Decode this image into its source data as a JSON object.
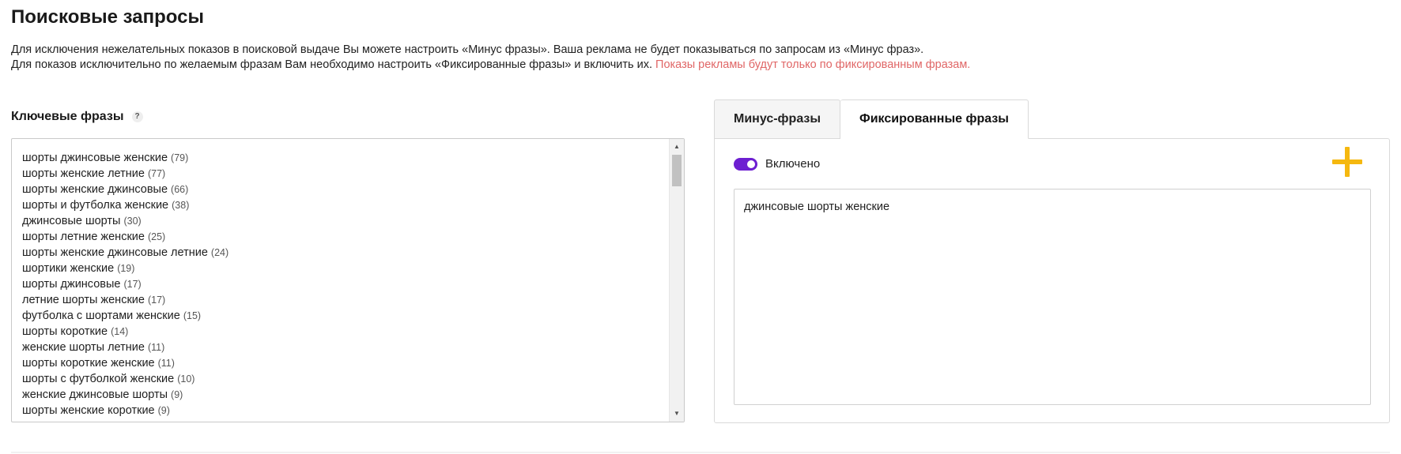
{
  "page": {
    "title": "Поисковые запросы",
    "description": {
      "line1": "Для исключения нежелательных показов в поисковой выдаче Вы можете настроить «Минус фразы». Ваша реклама не будет показываться по запросам из «Минус фраз».",
      "line2": "Для показов исключительно по желаемым фразам Вам необходимо настроить «Фиксированные фразы» и включить их.",
      "line2_accent": "Показы рекламы будут только по фиксированным фразам."
    }
  },
  "keywords": {
    "label": "Ключевые фразы",
    "help_icon": "question-icon",
    "help_glyph": "?",
    "items": [
      {
        "phrase": "шорты джинсовые женские",
        "count": "(79)"
      },
      {
        "phrase": "шорты женские летние",
        "count": "(77)"
      },
      {
        "phrase": "шорты женские джинсовые",
        "count": "(66)"
      },
      {
        "phrase": "шорты и футболка женские",
        "count": "(38)"
      },
      {
        "phrase": "джинсовые шорты",
        "count": "(30)"
      },
      {
        "phrase": "шорты летние женские",
        "count": "(25)"
      },
      {
        "phrase": "шорты женские джинсовые летние",
        "count": "(24)"
      },
      {
        "phrase": "шортики женские",
        "count": "(19)"
      },
      {
        "phrase": "шорты джинсовые",
        "count": "(17)"
      },
      {
        "phrase": "летние шорты женские",
        "count": "(17)"
      },
      {
        "phrase": "футболка с шортами женские",
        "count": "(15)"
      },
      {
        "phrase": "шорты короткие",
        "count": "(14)"
      },
      {
        "phrase": "женские шорты летние",
        "count": "(11)"
      },
      {
        "phrase": "шорты короткие женские",
        "count": "(11)"
      },
      {
        "phrase": "шорты с футболкой женские",
        "count": "(10)"
      },
      {
        "phrase": "женские джинсовые шорты",
        "count": "(9)"
      },
      {
        "phrase": "шорты женские короткие",
        "count": "(9)"
      }
    ],
    "scroll_up_glyph": "▲",
    "scroll_down_glyph": "▼"
  },
  "tabs": [
    {
      "label": "Минус-фразы",
      "active": false
    },
    {
      "label": "Фиксированные фразы",
      "active": true
    }
  ],
  "fixed_panel": {
    "toggle_label": "Включено",
    "toggle_on": true,
    "toggle_color": "#6d1fd1",
    "add_icon": "plus-icon",
    "add_icon_color": "#f5b80f",
    "textarea_value": "джинсовые шорты женские"
  },
  "colors": {
    "accent_text": "#e06666"
  }
}
